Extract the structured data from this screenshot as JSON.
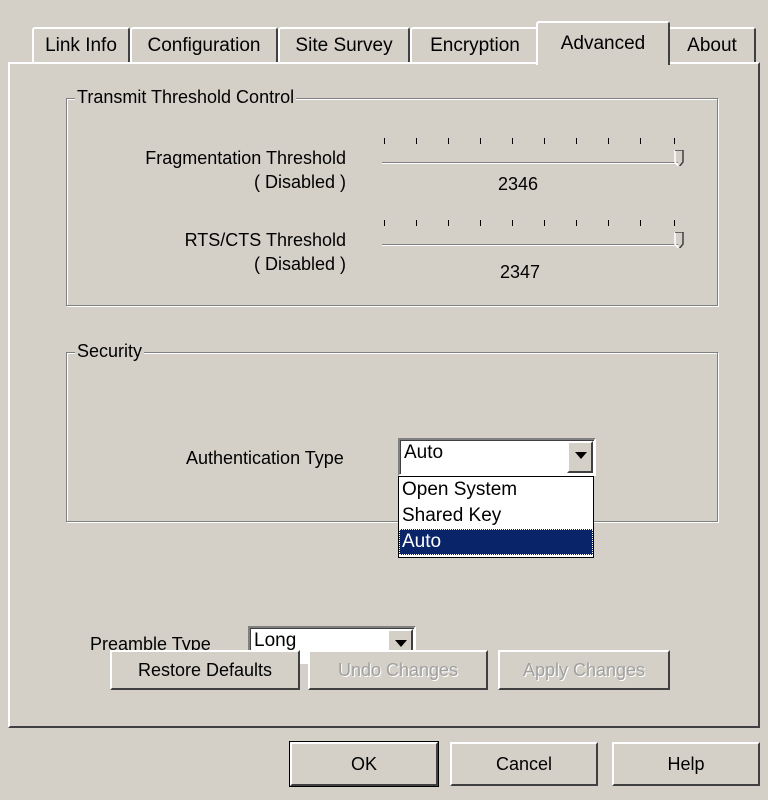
{
  "tabs": [
    {
      "label": "Link Info"
    },
    {
      "label": "Configuration"
    },
    {
      "label": "Site Survey"
    },
    {
      "label": "Encryption"
    },
    {
      "label": "Advanced",
      "active": true
    },
    {
      "label": "About"
    }
  ],
  "threshold_group": {
    "title": "Transmit Threshold Control",
    "fragmentation": {
      "label": "Fragmentation Threshold",
      "status": "( Disabled )",
      "value": "2346"
    },
    "rts_cts": {
      "label": "RTS/CTS Threshold",
      "status": "( Disabled )",
      "value": "2347"
    }
  },
  "security_group": {
    "title": "Security",
    "auth_label": "Authentication Type",
    "auth_selected": "Auto",
    "auth_options": [
      "Open System",
      "Shared Key",
      "Auto"
    ]
  },
  "preamble": {
    "label": "Preamble Type",
    "selected": "Long"
  },
  "panel_buttons": {
    "restore": "Restore Defaults",
    "undo": "Undo Changes",
    "apply": "Apply Changes"
  },
  "dialog_buttons": {
    "ok": "OK",
    "cancel": "Cancel",
    "help": "Help"
  },
  "colors": {
    "face": "#d4d0c8",
    "highlight": "#0a246a",
    "disabled_text": "#a0a0a0"
  }
}
